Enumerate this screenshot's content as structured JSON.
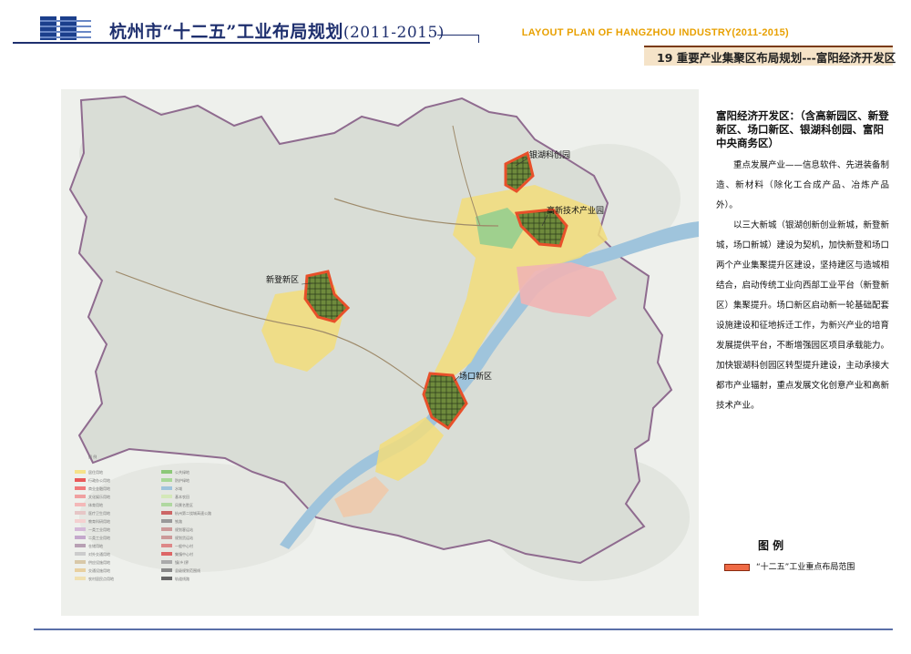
{
  "header": {
    "title_main": "杭州市“十二五”工业布局规划",
    "title_years": "(2011-2015)",
    "title_en": "LAYOUT PLAN OF HANGZHOU INDUSTRY(2011-2015)",
    "subtitle": "19 重要产业集聚区布局规划---富阳经济开发区"
  },
  "map": {
    "callouts": [
      {
        "id": "yinhu",
        "label": "银湖科创园"
      },
      {
        "id": "gaoxin",
        "label": "高新技术产业园"
      },
      {
        "id": "xindeng",
        "label": "新登新区"
      },
      {
        "id": "changkou",
        "label": "场口新区"
      }
    ],
    "small_legend": {
      "title": "图 例",
      "items_left": [
        "居住用地",
        "行政办公用地",
        "商业金融用地",
        "文化娱乐用地",
        "体育用地",
        "医疗卫生用地",
        "教育科研用地",
        "一类工业用地",
        "二类工业用地",
        "仓储用地",
        "对外交通用地",
        "供应设施用地",
        "交通设施用地",
        "农村居民点用地"
      ],
      "items_right": [
        "公共绿地",
        "防护绿地",
        "水域",
        "基本农田",
        "风景名胜区",
        "杭州第二绕城高速公路",
        "铁路",
        "规划客运站",
        "规划货运站",
        "一般中心村",
        "集镇中心村",
        "镇(乡)界",
        "县级规划范围线",
        "轨道线路"
      ]
    },
    "colors": {
      "zone_fill": "#5a8a3a",
      "zone_border": "#e8502a",
      "river": "#9fc4dc",
      "urban_yellow": "#f5e28a",
      "urban_pink": "#f0b4b4"
    }
  },
  "info": {
    "zone_title": "富阳经济开发区：（含高新园区、新登新区、场口新区、银湖科创园、富阳中央商务区）",
    "paragraph1": "重点发展产业——信息软件、先进装备制造、新材料（除化工合成产品、冶炼产品外）。",
    "paragraph2": "以三大新城（银湖创新创业新城，新登新城，场口新城）建设为契机，加快新登和场口两个产业集聚提升区建设，坚持建区与造城相结合，启动传统工业向西部工业平台（新登新区）集聚提升。场口新区启动新一轮基础配套设施建设和征地拆迁工作，为新兴产业的培育发展提供平台，不断增强园区项目承载能力。加快银湖科创园区转型提升建设，主动承接大都市产业辐射，重点发展文化创意产业和高新技术产业。"
  },
  "legend": {
    "heading": "图 例",
    "item_label": "“十二五”工业重点布局范围",
    "item_color": "#ef6a45"
  }
}
